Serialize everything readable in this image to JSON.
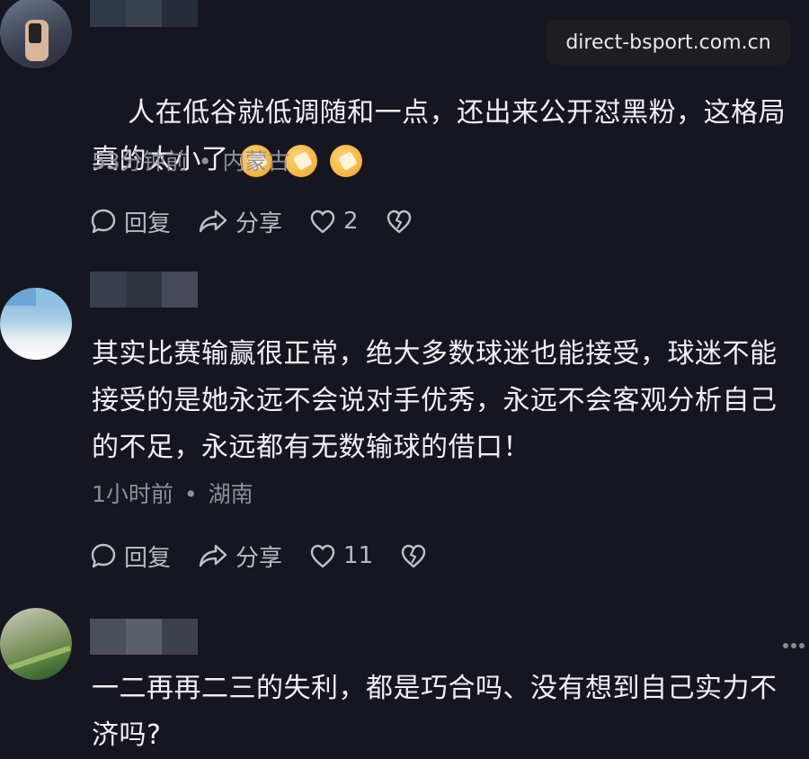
{
  "watermark": "direct-bsport.com.cn",
  "comments": [
    {
      "text": "人在低谷就低调随和一点，还出来公开怼黑粉，这格局真的太小了",
      "time": "53分钟前",
      "location": "内蒙古",
      "reply_label": "回复",
      "share_label": "分享",
      "likes": "2"
    },
    {
      "text": "其实比赛输赢很正常，绝大多数球迷也能接受，球迷不能接受的是她永远不会说对手优秀，永远不会客观分析自己的不足，永远都有无数输球的借口！",
      "time": "1小时前",
      "location": "湖南",
      "reply_label": "回复",
      "share_label": "分享",
      "likes": "11"
    },
    {
      "text": "一二再再二三的失利，都是巧合吗、没有想到自己实力不济吗?"
    }
  ],
  "separator": "•",
  "icons": {
    "reply": "comment-bubble-icon",
    "share": "share-arrow-icon",
    "like": "heart-icon",
    "dislike": "broken-heart-icon",
    "more": "more-dots-icon",
    "emoji": "facepalm-emoji-icon"
  }
}
